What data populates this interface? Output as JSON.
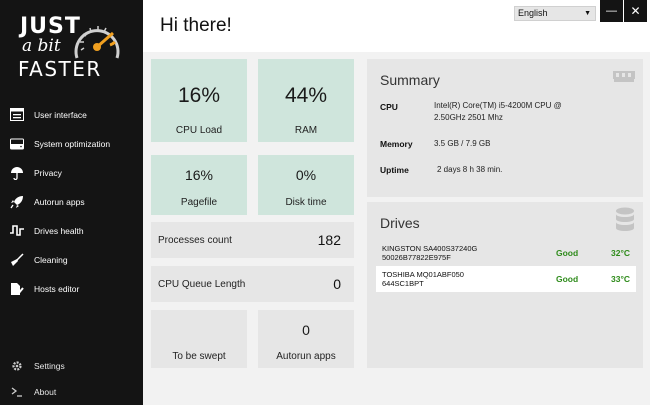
{
  "app": {
    "logo": {
      "line1": "JUST",
      "line2": "a bit",
      "line3": "FASTER"
    }
  },
  "sidebar": {
    "items": [
      {
        "label": "User interface",
        "icon": "window-icon"
      },
      {
        "label": "System optimization",
        "icon": "drive-icon"
      },
      {
        "label": "Privacy",
        "icon": "umbrella-icon"
      },
      {
        "label": "Autorun apps",
        "icon": "rocket-icon"
      },
      {
        "label": "Drives health",
        "icon": "pulse-icon"
      },
      {
        "label": "Cleaning",
        "icon": "broom-icon"
      },
      {
        "label": "Hosts editor",
        "icon": "file-edit-icon"
      }
    ],
    "bottom": [
      {
        "label": "Settings",
        "icon": "gear-icon"
      },
      {
        "label": "About",
        "icon": "terminal-icon"
      }
    ]
  },
  "header": {
    "greeting": "Hi there!",
    "language": "English",
    "minimize": "—",
    "close": "✕"
  },
  "stats": {
    "cpu": {
      "value": "16%",
      "label": "CPU Load"
    },
    "ram": {
      "value": "44%",
      "label": "RAM"
    },
    "pagefile": {
      "value": "16%",
      "label": "Pagefile"
    },
    "disk": {
      "value": "0%",
      "label": "Disk time"
    },
    "processes": {
      "label": "Processes count",
      "value": "182"
    },
    "queue": {
      "label": "CPU Queue Length",
      "value": "0"
    },
    "swept": {
      "value": "",
      "label": "To be swept"
    },
    "autorun": {
      "value": "0",
      "label": "Autorun apps"
    }
  },
  "summary": {
    "title": "Summary",
    "cpu_key": "CPU",
    "cpu_val": "Intel(R) Core(TM) i5-4200M CPU @ 2.50GHz 2501 Mhz",
    "memory_key": "Memory",
    "memory_val": "3.5 GB / 7.9 GB",
    "uptime_key": "Uptime",
    "uptime_val": "2 days 8 h 38 min."
  },
  "drives": {
    "title": "Drives",
    "rows": [
      {
        "name1": "KINGSTON SA400S37240G",
        "name2": "50026B77822E975F",
        "status": "Good",
        "temp": "32°C"
      },
      {
        "name1": "TOSHIBA MQ01ABF050",
        "name2": "644SC1BPT",
        "status": "Good",
        "temp": "33°C"
      }
    ]
  },
  "colors": {
    "sidebar": "#141414",
    "tile_green": "#cfe5dc",
    "tile_grey": "#e6e6e6",
    "good": "#2e8b1a",
    "gauge_accent": "#f0a020"
  }
}
